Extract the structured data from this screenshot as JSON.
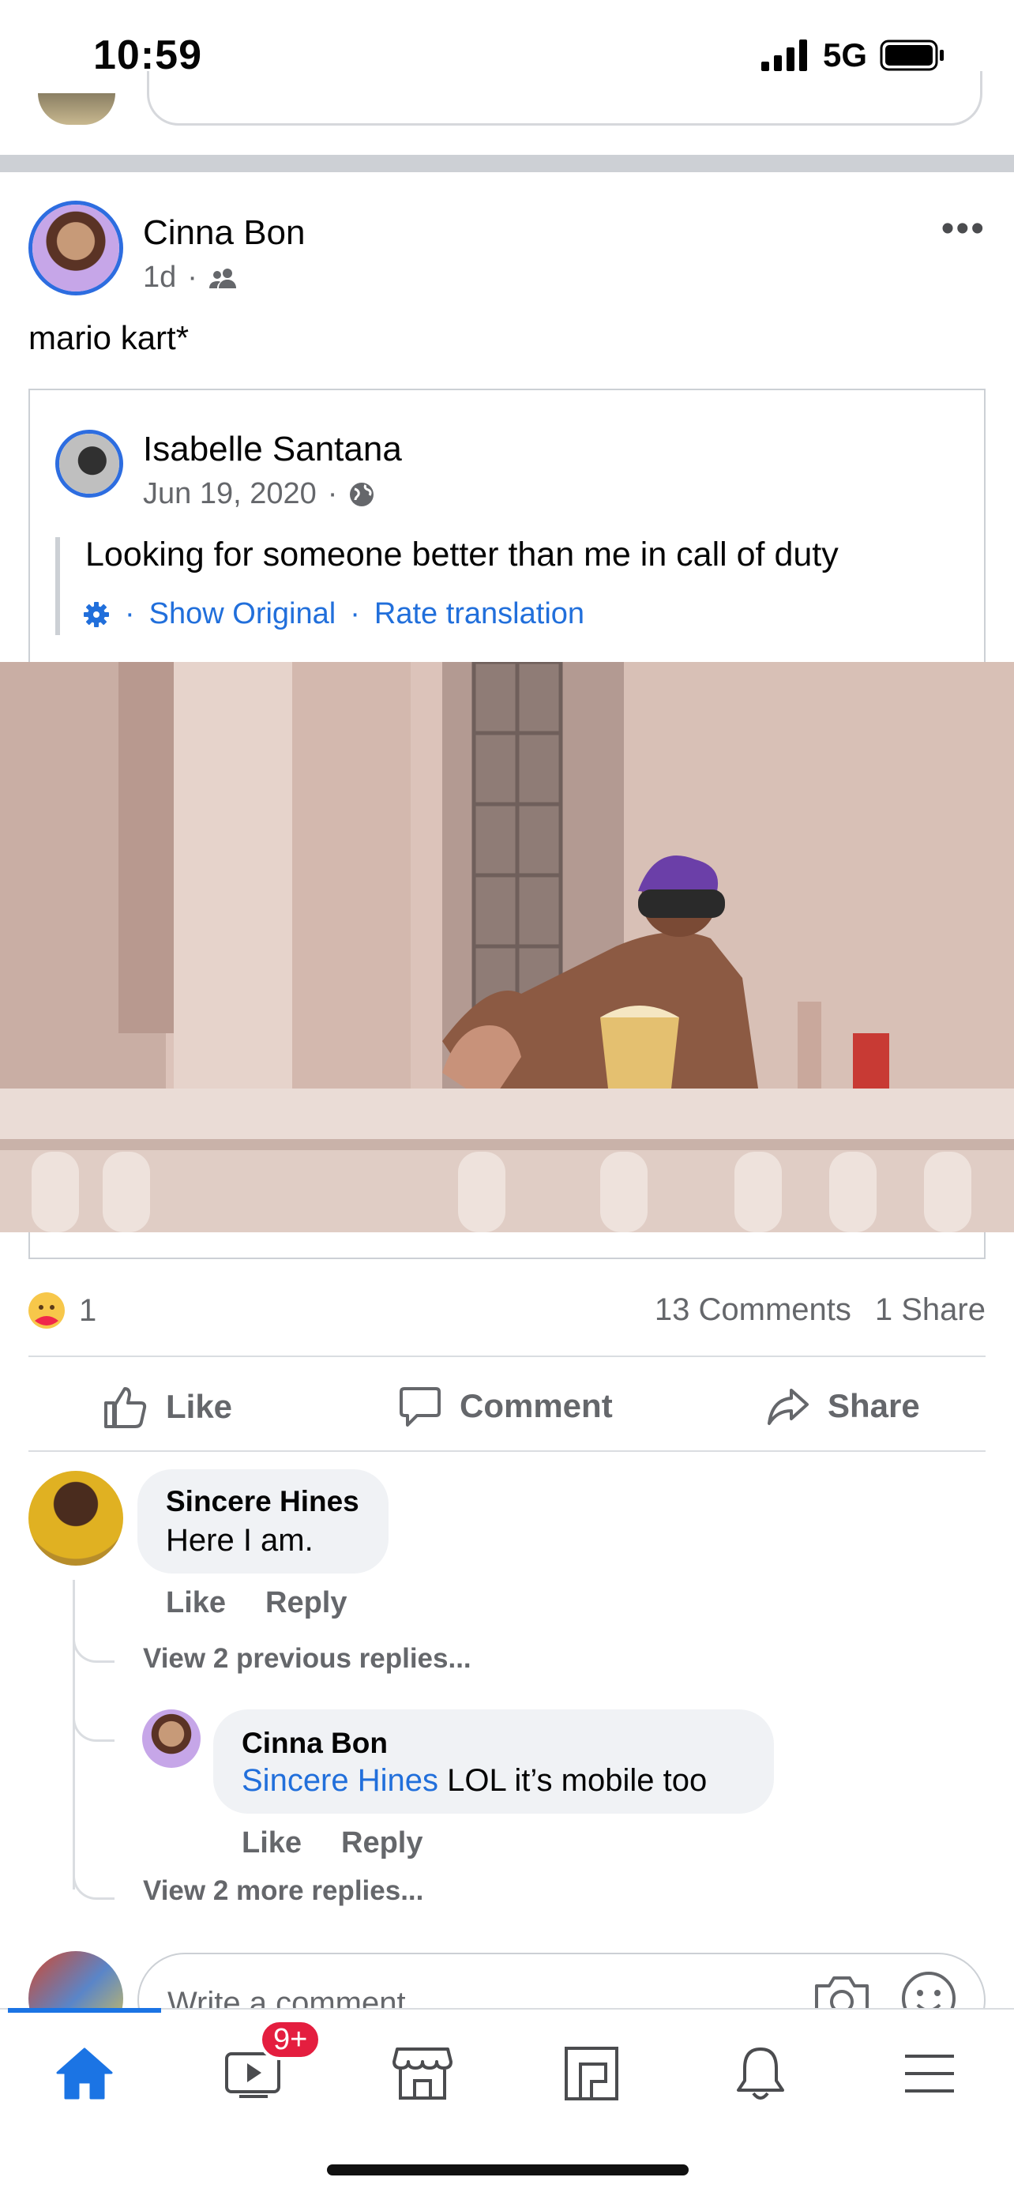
{
  "status_bar": {
    "time": "10:59",
    "network": "5G",
    "signal": "signal-bars-icon",
    "battery": "battery-icon"
  },
  "post": {
    "author": "Cinna Bon",
    "time": "1d",
    "audience_icon": "friends-icon",
    "text": "mario kart*",
    "more_icon": "more-horizontal-icon",
    "shared": {
      "author": "Isabelle Santana",
      "date": "Jun 19, 2020",
      "audience_icon": "globe-icon",
      "text": "Looking for someone better than me in call of duty",
      "translation": {
        "settings_icon": "gear-icon",
        "show_original": "Show Original",
        "rate": "Rate translation",
        "separator": "·"
      }
    },
    "image_alt": "person with binoculars eating popcorn on balcony"
  },
  "stats": {
    "reaction_count": "1",
    "reaction_icon": "care-emoji-icon",
    "comments": "13 Comments",
    "shares": "1 Share"
  },
  "actions": {
    "like": "Like",
    "comment": "Comment",
    "share": "Share"
  },
  "comments": [
    {
      "author": "Sincere Hines",
      "text": "Here I am.",
      "like": "Like",
      "reply": "Reply",
      "view_previous": "View 2 previous replies...",
      "reply_item": {
        "author": "Cinna Bon",
        "mention": "Sincere Hines",
        "text": " LOL it’s mobile too",
        "like": "Like",
        "reply": "Reply"
      },
      "view_more": "View 2 more replies..."
    }
  ],
  "write_comment": {
    "placeholder": "Write a comment...",
    "camera_icon": "camera-icon",
    "emoji_icon": "emoji-icon"
  },
  "nav": {
    "items": [
      "home-icon",
      "watch-icon",
      "marketplace-icon",
      "pages-icon",
      "bell-icon",
      "menu-icon"
    ],
    "watch_badge": "9+",
    "accent": "#1b74e4"
  }
}
